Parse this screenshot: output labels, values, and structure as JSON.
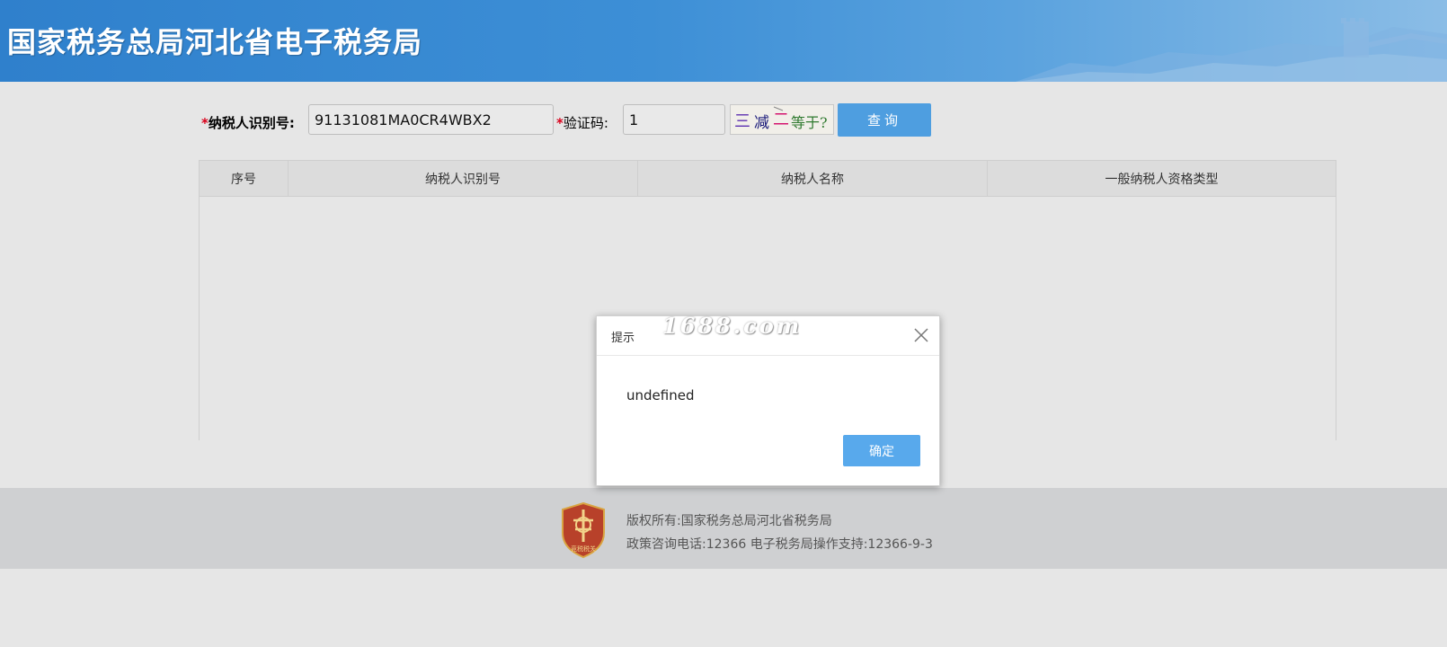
{
  "header": {
    "title": "国家税务总局河北省电子税务局"
  },
  "search": {
    "taxpayer_id_label": "纳税人识别号:",
    "taxpayer_id_value": "91131081MA0CR4WBX2",
    "captcha_label": "验证码:",
    "captcha_value": "1",
    "captcha_text": "三减二等于?",
    "query_label": "查询",
    "required_mark": "*"
  },
  "table": {
    "columns": [
      "序号",
      "纳税人识别号",
      "纳税人名称",
      "一般纳税人资格类型"
    ],
    "rows": []
  },
  "dialog": {
    "title": "提示",
    "message": "undefined",
    "ok_label": "确定"
  },
  "watermark": {
    "text": "1688.com"
  },
  "footer": {
    "copyright": "版权所有:国家税务总局河北省税务局",
    "contact": "政策咨询电话:12366  电子税务局操作支持:12366-9-3",
    "emblem_text": "竞税税关"
  },
  "colors": {
    "banner": "#3a8ad4",
    "primary_button": "#4e9ee0",
    "required": "#d9001b",
    "dialog_button": "#58a9ec"
  }
}
